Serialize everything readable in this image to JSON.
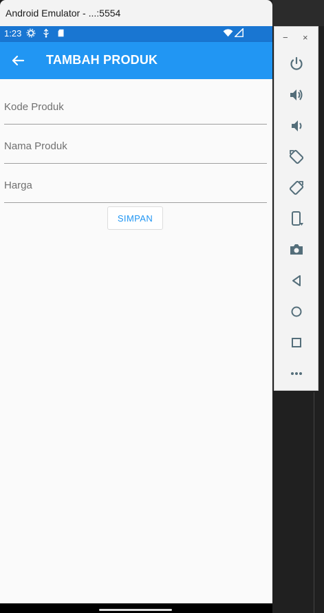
{
  "window": {
    "title": "Android Emulator - ...:5554"
  },
  "statusbar": {
    "time": "1:23",
    "icons": [
      "settings-gear-icon",
      "usb-debug-icon",
      "sd-card-icon",
      "wifi-icon",
      "signal-icon"
    ]
  },
  "appbar": {
    "back_icon": "arrow-left-icon",
    "title": "TAMBAH PRODUK",
    "color": "#2196f3",
    "status_color": "#1976d2"
  },
  "form": {
    "kode": {
      "value": "",
      "placeholder": "Kode Produk"
    },
    "nama": {
      "value": "",
      "placeholder": "Nama Produk"
    },
    "harga": {
      "value": "",
      "placeholder": "Harga"
    },
    "save_label": "SIMPAN"
  },
  "emulator_tools": {
    "minimize": "−",
    "close": "×",
    "items": [
      "power-icon",
      "volume-up-icon",
      "volume-down-icon",
      "rotate-left-icon",
      "rotate-right-icon",
      "fold-device-icon",
      "camera-icon",
      "back-triangle-icon",
      "home-circle-icon",
      "overview-square-icon",
      "more-dots-icon"
    ]
  },
  "colors": {
    "accent": "#2196f3",
    "tool_icon": "#546e7a"
  }
}
